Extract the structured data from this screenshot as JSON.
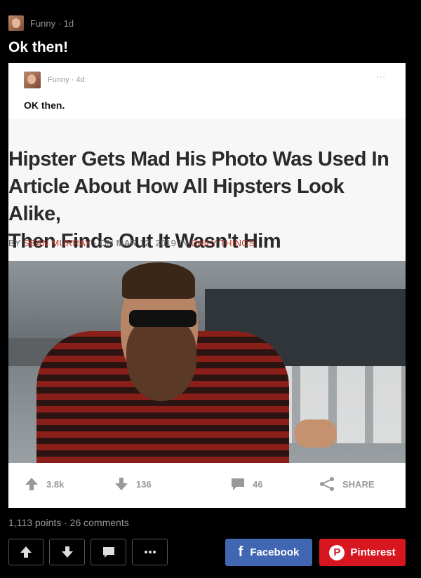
{
  "post": {
    "section_meta": "Funny · 1d",
    "title": "Ok then!"
  },
  "embedded": {
    "section_meta": "Funny · 4d",
    "more_label": "···",
    "title": "OK then.",
    "headline_lines": [
      "Hipster Gets Mad His Photo Was Used In",
      "Article About How All Hipsters Look Alike,",
      "Then Finds Out It Wasn't Him"
    ],
    "byline_prefix": "BY ",
    "byline_author": "SEAN MURRAY",
    "byline_middle": " - ON MAR 12, 2019 IN ",
    "byline_category": "DAILY THINGS",
    "upvotes": "3.8k",
    "downvotes": "136",
    "comments": "46",
    "share_label": "SHARE"
  },
  "stats": {
    "text": "1,113 points · 26 comments"
  },
  "share": {
    "facebook_label": "Facebook",
    "facebook_icon": "f",
    "pinterest_label": "Pinterest",
    "pinterest_icon": "P"
  },
  "colors": {
    "facebook": "#4267b2",
    "pinterest": "#d8161f",
    "byline_accent": "#c0392b"
  }
}
